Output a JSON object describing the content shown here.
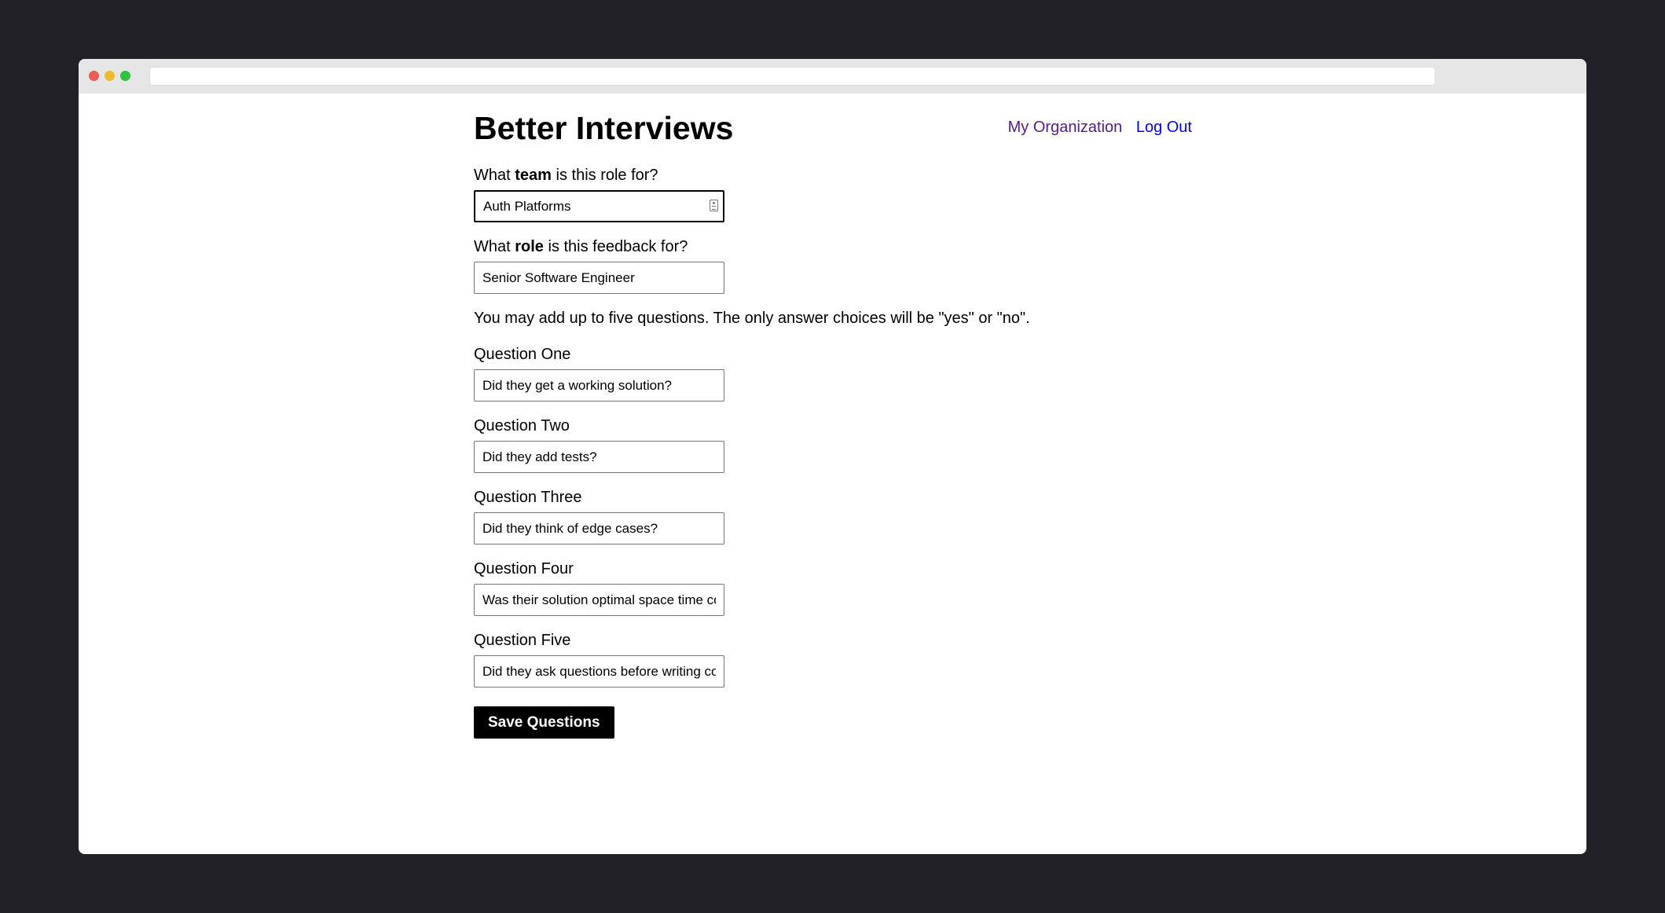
{
  "header": {
    "title": "Better Interviews",
    "nav": {
      "my_organization": "My Organization",
      "log_out": "Log Out"
    }
  },
  "form": {
    "team": {
      "label_prefix": "What ",
      "label_bold": "team",
      "label_suffix": " is this role for?",
      "value": "Auth Platforms"
    },
    "role": {
      "label_prefix": "What ",
      "label_bold": "role",
      "label_suffix": " is this feedback for?",
      "value": "Senior Software Engineer"
    },
    "info": "You may add up to five questions. The only answer choices will be \"yes\" or \"no\".",
    "questions": [
      {
        "label": "Question One",
        "value": "Did they get a working solution?"
      },
      {
        "label": "Question Two",
        "value": "Did they add tests?"
      },
      {
        "label": "Question Three",
        "value": "Did they think of edge cases?"
      },
      {
        "label": "Question Four",
        "value": "Was their solution optimal space time complexity?"
      },
      {
        "label": "Question Five",
        "value": "Did they ask questions before writing code?"
      }
    ],
    "save_label": "Save Questions"
  },
  "icons": {
    "autofill": "contact-card-icon"
  },
  "colors": {
    "background": "#222127",
    "link_visited": "#551a8b",
    "link": "#0000ee",
    "button_bg": "#000000",
    "button_text": "#ffffff"
  }
}
